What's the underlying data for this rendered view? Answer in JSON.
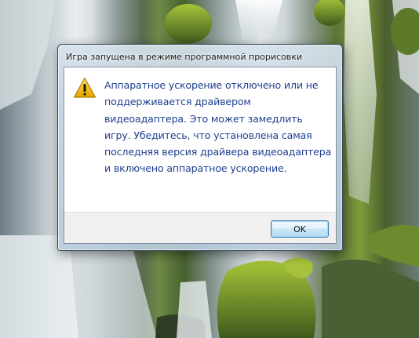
{
  "dialog": {
    "title": "Игра запущена в режиме программной прорисовки",
    "icon": "warning-icon",
    "message": "Аппаратное ускорение отключено или не поддерживается драйвером видеоадаптера. Это может замедлить игру. Убедитесь, что установлена самая последняя версия драйвера видеоадаптера и включено аппаратное ускорение.",
    "ok_label": "OK"
  },
  "colors": {
    "message_text": "#1e3f8f",
    "warning_yellow": "#f5c21b",
    "button_border": "#3c7fb1"
  }
}
